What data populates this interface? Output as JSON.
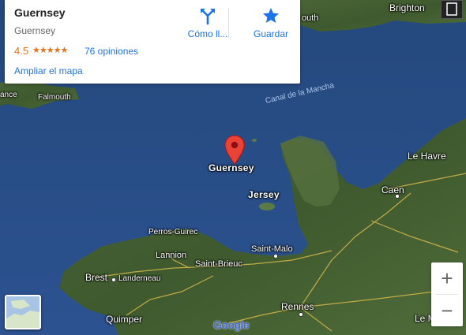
{
  "place_card": {
    "title": "Guernsey",
    "subtitle": "Guernsey",
    "rating": "4.5",
    "stars_icon": "★★★★★",
    "reviews": "76 opiniones",
    "directions_label": "Cómo ll...",
    "save_label": "Guardar",
    "enlarge_map_link": "Ampliar el mapa"
  },
  "map_labels": {
    "brighton": "Brighton",
    "south": "outh",
    "cornwall": "ance",
    "falmouth": "Falmouth",
    "channel": "Canal de la Mancha",
    "guernsey": "Guernsey",
    "jersey": "Jersey",
    "le_havre": "Le Havre",
    "caen": "Caen",
    "perros_guirec": "Perros-Guirec",
    "lannion": "Lannion",
    "saint_brieuc": "Saint-Brieuc",
    "saint_malo": "Saint-Malo",
    "brest": "Brest",
    "landerneau": "Landerneau",
    "rennes": "Rennes",
    "quimper": "Quimper",
    "le_m": "Le M"
  },
  "controls": {
    "zoom_in": "+",
    "zoom_out": "−",
    "google_logo": "Google"
  },
  "colors": {
    "sea": "#2a4f86",
    "land": "#3d5a2c",
    "accent_blue": "#1a73e8",
    "rating_orange": "#e7711b",
    "pin_red": "#ea4335"
  }
}
